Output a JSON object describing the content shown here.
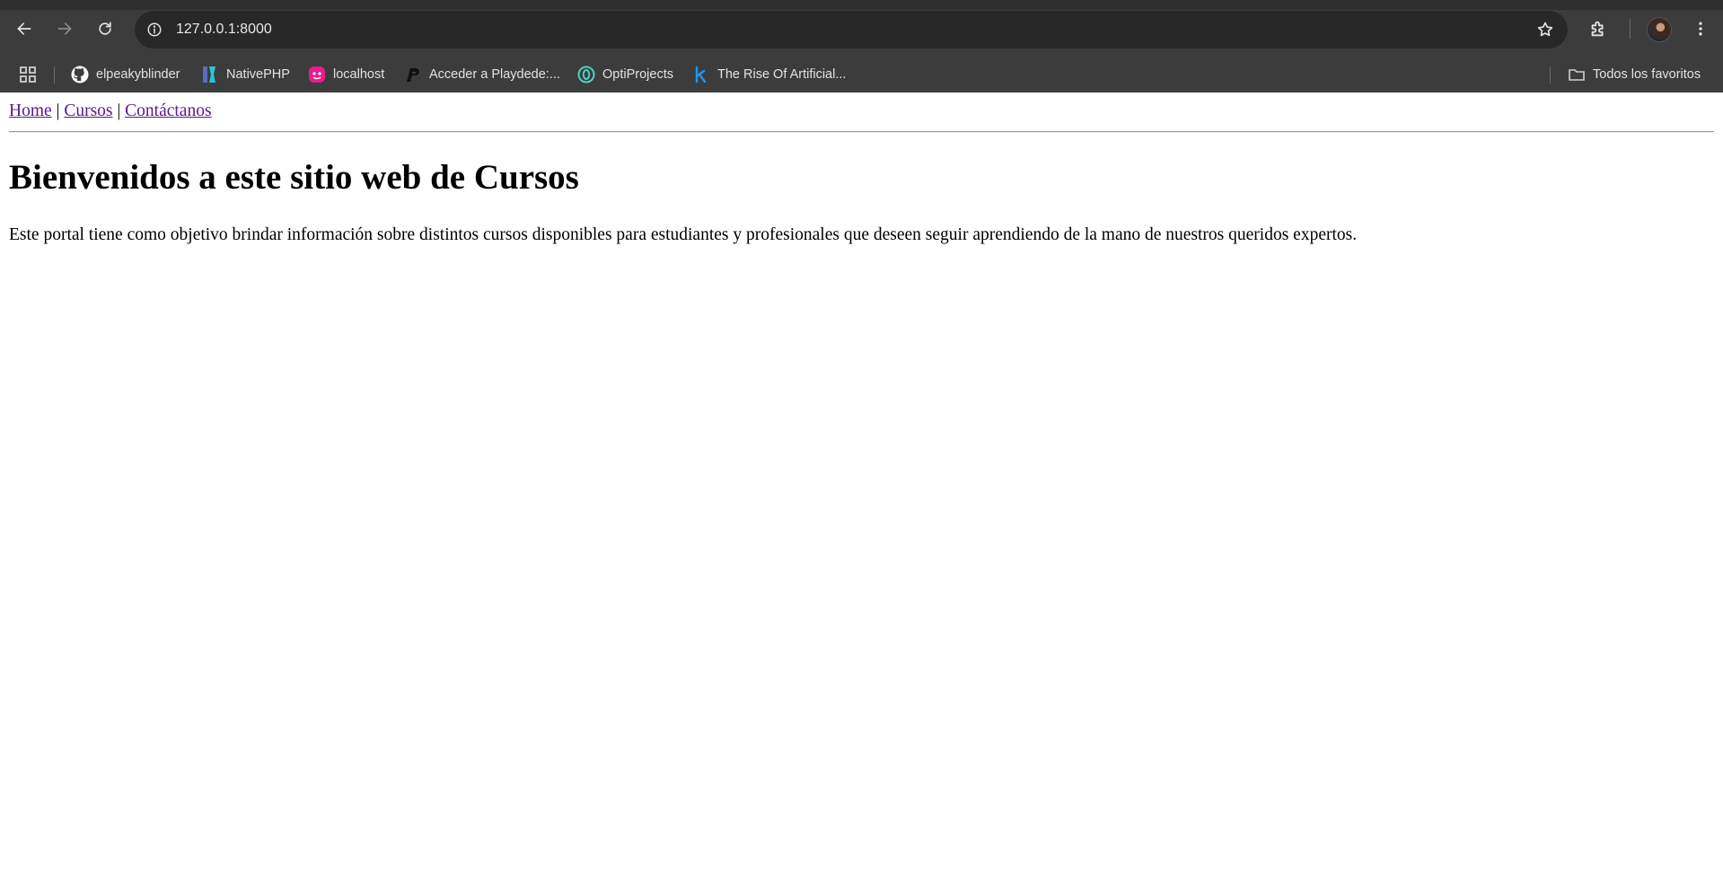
{
  "browser": {
    "url": "127.0.0.1:8000",
    "bookmarks": [
      {
        "label": "elpeakyblinder",
        "icon": "github-icon"
      },
      {
        "label": "NativePHP",
        "icon": "nativephp-icon"
      },
      {
        "label": "localhost",
        "icon": "localhost-icon"
      },
      {
        "label": "Acceder a Playdede:...",
        "icon": "playdede-icon"
      },
      {
        "label": "OptiProjects",
        "icon": "optiprojects-icon"
      },
      {
        "label": "The Rise Of Artificial...",
        "icon": "k-icon"
      }
    ],
    "all_bookmarks_label": "Todos los favoritos"
  },
  "nav": {
    "home": "Home",
    "cursos": "Cursos",
    "contact": "Contáctanos",
    "separator": "|"
  },
  "main": {
    "title": "Bienvenidos a este sitio web de Cursos",
    "description": "Este portal tiene como objetivo brindar información sobre distintos cursos disponibles para estudiantes y profesionales que deseen seguir aprendiendo de la mano de nuestros queridos expertos."
  },
  "colors": {
    "chrome_bg": "#3c3c3c",
    "omnibox_bg": "#282828",
    "visited_link": "#551a8b"
  }
}
